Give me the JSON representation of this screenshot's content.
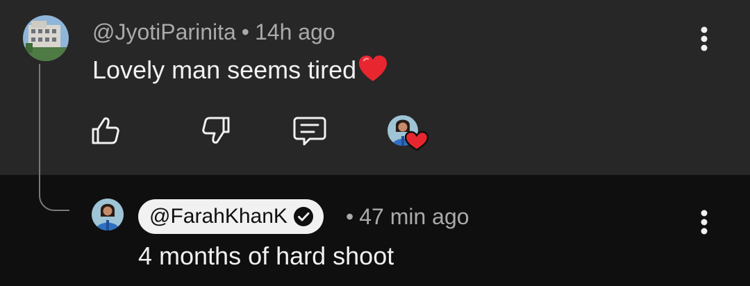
{
  "comment": {
    "author": "@JyotiParinita",
    "separator": "•",
    "time": "14h ago",
    "text": "Lovely man seems tired",
    "emoji": "heart-emoji",
    "actions": [
      "like-icon",
      "dislike-icon",
      "reply-icon"
    ],
    "creator_heart": "creator-heart-badge"
  },
  "reply": {
    "author": "@FarahKhanK",
    "verified": true,
    "separator": "•",
    "time": "47 min ago",
    "text": "4 months of hard shoot"
  },
  "colors": {
    "top_bg": "#272727",
    "bottom_bg": "#0f0f0f",
    "meta_text": "#aaaaaa",
    "heart": "#e8262f"
  }
}
